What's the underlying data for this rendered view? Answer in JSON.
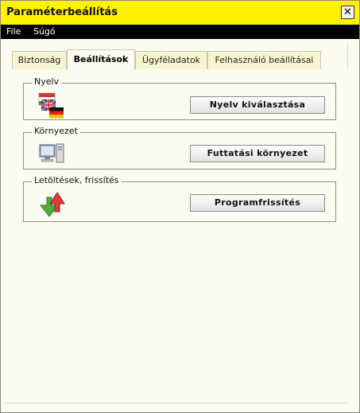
{
  "window": {
    "title": "Paraméterbeállítás",
    "close_glyph": "✕"
  },
  "menu": {
    "file": "File",
    "help": "Súgó"
  },
  "tabs": [
    {
      "label": "Biztonság",
      "active": false
    },
    {
      "label": "Beállítások",
      "active": true
    },
    {
      "label": "Ügyféladatok",
      "active": false
    },
    {
      "label": "Felhasználó beállításai",
      "active": false
    }
  ],
  "groups": {
    "language": {
      "label": "Nyelv",
      "button": "Nyelv kiválasztása",
      "icon": "flags-icon"
    },
    "environment": {
      "label": "Környezet",
      "button": "Futtatási környezet",
      "icon": "computer-icon"
    },
    "updates": {
      "label": "Letöltések, frissítés",
      "button": "Programfrissítés",
      "icon": "update-arrows-icon"
    }
  },
  "colors": {
    "titlebar": "#fff200",
    "menubar": "#000000",
    "tab_inactive": "#f7f5cf"
  }
}
